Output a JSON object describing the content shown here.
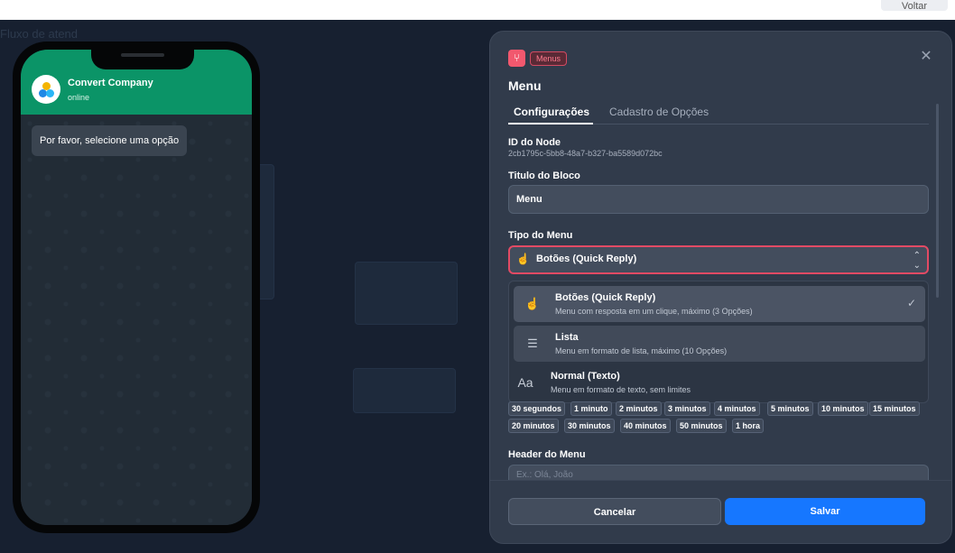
{
  "topbar": {
    "voltar_label": "Voltar"
  },
  "background": {
    "title": "Fluxo de atend"
  },
  "phone": {
    "company_name": "Convert Company",
    "status": "online",
    "message": "Por favor, selecione uma opção"
  },
  "modal": {
    "badge": "Menus",
    "title": "Menu",
    "tabs": [
      "Configurações",
      "Cadastro de Opções"
    ],
    "node_id_label": "ID do Node",
    "node_id": "2cb1795c-5bb8-48a7-b327-ba5589d072bc",
    "titulo_label": "Titulo do Bloco",
    "titulo_value": "Menu",
    "tipo_label": "Tipo do Menu",
    "tipo_value": "Botões (Quick Reply)",
    "options": [
      {
        "title": "Botões (Quick Reply)",
        "desc": "Menu com resposta em um clique, máximo (3 Opções)",
        "icon": "touch-icon",
        "selected": true
      },
      {
        "title": "Lista",
        "desc": "Menu em formato de lista, máximo (10 Opções)",
        "icon": "list-icon",
        "selected": false
      },
      {
        "title": "Normal (Texto)",
        "desc": "Menu em formato de texto, sem limites",
        "icon": "text-icon",
        "selected": false
      }
    ],
    "timeouts_row1": [
      "30 segundos",
      "1 minuto",
      "2 minutos",
      "3 minutos",
      "4 minutos",
      "5 minutos",
      "10 minutos",
      "15 minutos"
    ],
    "timeouts_row2": [
      "20 minutos",
      "30 minutos",
      "40 minutos",
      "50 minutos",
      "1 hora"
    ],
    "header_label": "Header do Menu",
    "header_placeholder": "Ex.: Olá, João",
    "cancel_label": "Cancelar",
    "save_label": "Salvar"
  },
  "colors": {
    "accent": "#1677ff",
    "danger": "#e24a64",
    "whatsapp_green": "#0b9467"
  }
}
